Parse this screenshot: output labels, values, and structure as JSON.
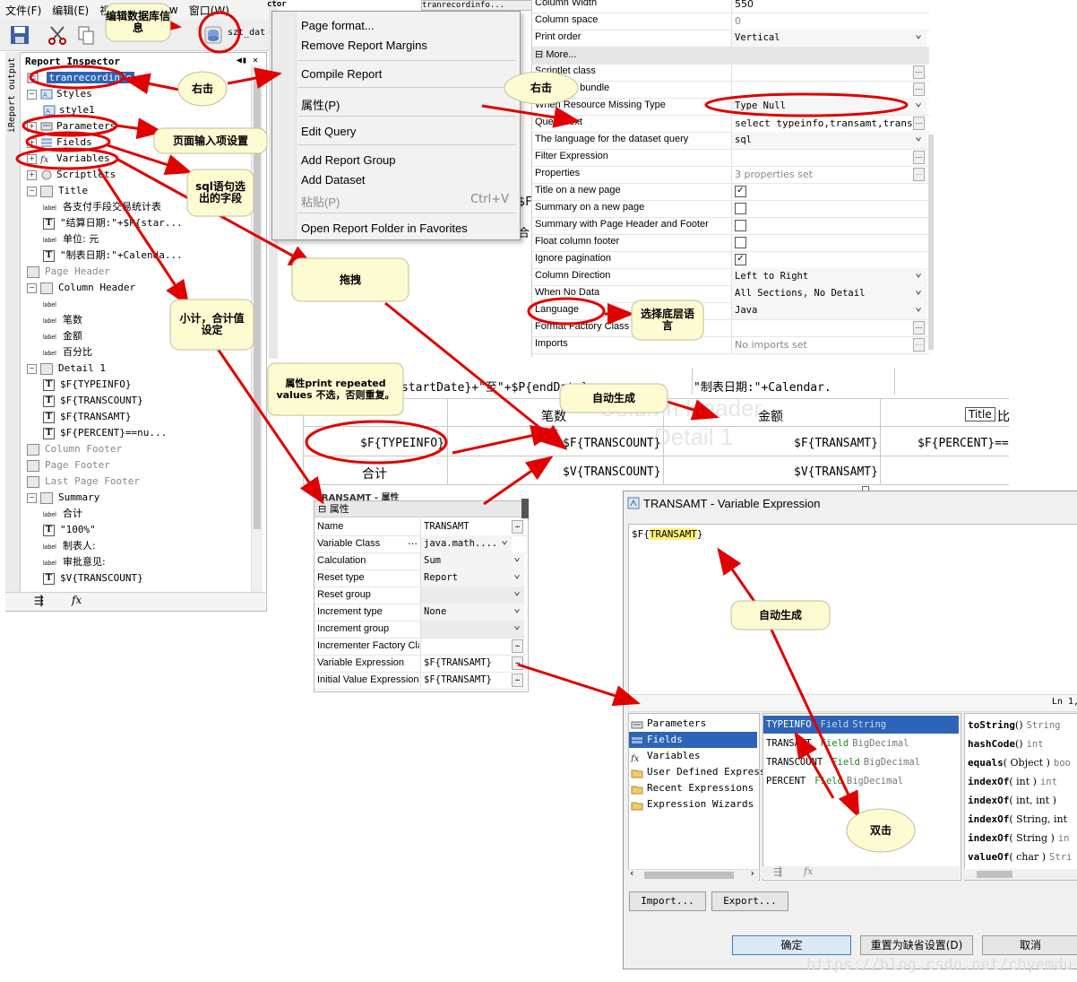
{
  "menubar": {
    "items": [
      "文件(F)",
      "编辑(E)",
      "视",
      "t",
      "Preview",
      "窗口(W)"
    ]
  },
  "toolbar": {
    "combo_value": "szt_dat"
  },
  "side_tabs": [
    "output",
    "iReport"
  ],
  "inspector": {
    "title": "Report Inspector",
    "controls": "◀▮ ✕",
    "root": "tranrecordinfo",
    "rows": [
      {
        "label": "Styles",
        "kind": "folder",
        "exp": "−"
      },
      {
        "label": "style1",
        "kind": "style"
      },
      {
        "label": "Parameters",
        "kind": "param",
        "exp": "+"
      },
      {
        "label": "Fields",
        "kind": "field",
        "exp": "+"
      },
      {
        "label": "Variables",
        "kind": "var",
        "exp": "+"
      },
      {
        "label": "Scriptlets",
        "kind": "scriptlet",
        "exp": "+"
      },
      {
        "label": "Title",
        "kind": "band",
        "exp": "−"
      },
      {
        "label": "各支付手段交易统计表",
        "kind": "label"
      },
      {
        "label": "\"结算日期:\"+$P{star...",
        "kind": "text"
      },
      {
        "label": "单位: 元",
        "kind": "label"
      },
      {
        "label": "\"制表日期:\"+Calenda...",
        "kind": "text"
      },
      {
        "label": "Page Header",
        "kind": "band",
        "muted": true
      },
      {
        "label": "Column Header",
        "kind": "band",
        "exp": "−"
      },
      {
        "label": "",
        "kind": "label"
      },
      {
        "label": "笔数",
        "kind": "label"
      },
      {
        "label": "金额",
        "kind": "label"
      },
      {
        "label": "百分比",
        "kind": "label"
      },
      {
        "label": "Detail 1",
        "kind": "band",
        "exp": "−"
      },
      {
        "label": "$F{TYPEINFO}",
        "kind": "text"
      },
      {
        "label": "$F{TRANSCOUNT}",
        "kind": "text"
      },
      {
        "label": "$F{TRANSAMT}",
        "kind": "text"
      },
      {
        "label": "$F{PERCENT}==nu...",
        "kind": "text"
      },
      {
        "label": "Column Footer",
        "kind": "band",
        "muted": true
      },
      {
        "label": "Page Footer",
        "kind": "band",
        "muted": true
      },
      {
        "label": "Last Page Footer",
        "kind": "band",
        "muted": true
      },
      {
        "label": "Summary",
        "kind": "band",
        "exp": "−"
      },
      {
        "label": "合计",
        "kind": "label"
      },
      {
        "label": "\"100%\"",
        "kind": "text"
      },
      {
        "label": "制表人:",
        "kind": "label"
      },
      {
        "label": "审批意见:",
        "kind": "label"
      },
      {
        "label": "$V{TRANSCOUNT}",
        "kind": "text"
      }
    ]
  },
  "context_menu": {
    "items": [
      {
        "label": "Page format..."
      },
      {
        "label": "Remove Report Margins"
      },
      {
        "label": "Compile Report"
      },
      {
        "label": "属性(P)"
      },
      {
        "label": "Edit Query"
      },
      {
        "label": "Add Report Group"
      },
      {
        "label": "Add Dataset"
      },
      {
        "label": "粘贴(P)",
        "shortcut": "Ctrl+V",
        "disabled": true
      },
      {
        "label": "Open Report Folder in Favorites"
      }
    ]
  },
  "mid_tab": "tranrecordinfo...",
  "mid_tab2": "ctor",
  "mid_peek": [
    "$F",
    "合"
  ],
  "props": {
    "rows": [
      {
        "name": "Column Width",
        "value": "550",
        "type": "text"
      },
      {
        "name": "Column space",
        "value": "0",
        "type": "text",
        "grey": true
      },
      {
        "name": "Print order",
        "value": "Vertical",
        "type": "combo"
      },
      {
        "name": "⊟ More...",
        "value": "",
        "type": "more"
      },
      {
        "name": "Scriptlet class",
        "value": "",
        "type": "dots"
      },
      {
        "name": "Resource bundle",
        "value": "",
        "type": "dots"
      },
      {
        "name": "When Resource Missing Type",
        "value": "Type Null",
        "type": "combo"
      },
      {
        "name": "Query Text",
        "value": "select typeinfo,transamt,trans...",
        "type": "dots"
      },
      {
        "name": "The language for the dataset query",
        "value": "sql",
        "type": "combo"
      },
      {
        "name": "Filter Expression",
        "value": "",
        "type": "dots"
      },
      {
        "name": "Properties",
        "value": "3 properties set",
        "type": "dots",
        "grey": true
      },
      {
        "name": "Title on a new page",
        "value": "✓",
        "type": "check"
      },
      {
        "name": "Summary on a new page",
        "value": "",
        "type": "check"
      },
      {
        "name": "Summary with Page Header and Footer",
        "value": "",
        "type": "check"
      },
      {
        "name": "Float column footer",
        "value": "",
        "type": "check"
      },
      {
        "name": "Ignore pagination",
        "value": "✓",
        "type": "check"
      },
      {
        "name": "Column Direction",
        "value": "Left to Right",
        "type": "combo"
      },
      {
        "name": "When No Data",
        "value": "All Sections, No Detail",
        "type": "combo"
      },
      {
        "name": "Language",
        "value": "Java",
        "type": "combo"
      },
      {
        "name": "Format Factory Class",
        "value": "",
        "type": "dots"
      },
      {
        "name": "Imports",
        "value": "No imports set",
        "type": "dots",
        "grey": true
      }
    ]
  },
  "design": {
    "top_left": "startDate}+\"至\"+$P{endDate}",
    "top_right": "\"制表日期:\"+Calendar.",
    "col_bishu": "笔数",
    "col_jine": "金额",
    "col_bi": "比",
    "title_tag": "Title",
    "ghost_header": "Column Header",
    "ghost_detail": "Detail 1",
    "det_type": "$F{TYPEINFO}",
    "det_count": "$F{TRANSCOUNT}",
    "det_amt": "$F{TRANSAMT}",
    "det_pct": "$F{PERCENT}==",
    "sum_label": "合计",
    "sum_count": "$V{TRANSCOUNT}",
    "sum_amt": "$V{TRANSAMT}"
  },
  "vprops": {
    "partial_header": "TRANSAMT - 属性",
    "header": "⊟ 属性",
    "rows": [
      {
        "name": "Name",
        "value": "TRANSAMT",
        "type": "dots"
      },
      {
        "name": "Variable Class",
        "value": "java.math....",
        "type": "combo_dots"
      },
      {
        "name": "Calculation",
        "value": "Sum",
        "type": "combo"
      },
      {
        "name": "Reset type",
        "value": "Report",
        "type": "combo"
      },
      {
        "name": "Reset group",
        "value": "",
        "type": "combo_dis"
      },
      {
        "name": "Increment type",
        "value": "None",
        "type": "combo"
      },
      {
        "name": "Increment group",
        "value": "",
        "type": "combo_dis"
      },
      {
        "name": "Incrementer Factory Cla",
        "value": "",
        "type": "dots"
      },
      {
        "name": "Variable Expression",
        "value": "$F{TRANSAMT}",
        "type": "dots"
      },
      {
        "name": "Initial Value Expression",
        "value": "$F{TRANSAMT}",
        "type": "dots"
      }
    ]
  },
  "dialog": {
    "title": "TRANSAMT - Variable Expression",
    "expr_prefix": "$F{",
    "expr_hl": "TRANSAMT",
    "expr_suffix": "}",
    "line_indicator": "Ln 1,",
    "pane1": [
      {
        "label": "Parameters",
        "icon": "param"
      },
      {
        "label": "Fields",
        "icon": "field",
        "sel": true
      },
      {
        "label": "Variables",
        "icon": "var"
      },
      {
        "label": "User Defined Express:",
        "icon": "folder"
      },
      {
        "label": "Recent Expressions",
        "icon": "folder"
      },
      {
        "label": "Expression Wizards",
        "icon": "folder"
      }
    ],
    "pane2": [
      {
        "name": "TYPEINFO",
        "kind": "Field",
        "type": "String",
        "sel": true
      },
      {
        "name": "TRANSAMT",
        "kind": "Field",
        "type": "BigDecimal"
      },
      {
        "name": "TRANSCOUNT",
        "kind": "Field",
        "type": "BigDecimal"
      },
      {
        "name": "PERCENT",
        "kind": "Field",
        "type": "BigDecimal"
      }
    ],
    "pane3": [
      {
        "m": "toString",
        "a": "()",
        "r": "String"
      },
      {
        "m": "hashCode",
        "a": "()",
        "r": "int"
      },
      {
        "m": "equals",
        "a": "( Object )",
        "r": "boo"
      },
      {
        "m": "indexOf",
        "a": "( int )",
        "r": "int"
      },
      {
        "m": "indexOf",
        "a": "( int, int )",
        "r": ""
      },
      {
        "m": "indexOf",
        "a": "( String, int",
        "r": ""
      },
      {
        "m": "indexOf",
        "a": "( String )",
        "r": "in"
      },
      {
        "m": "valueOf",
        "a": "( char )",
        "r": "Stri"
      }
    ],
    "import_label": "Import...",
    "export_label": "Export...",
    "ok_label": "确定",
    "reset_label": "重置为缺省设置(D)",
    "cancel_label": "取消"
  },
  "annotations": {
    "edit_db": "编辑数据库信息",
    "right_click_1": "右击",
    "right_click_2": "右击",
    "page_input": "页面输入项设置",
    "sql_fields": "sql语句选出的字段",
    "drag": "拖拽",
    "subtotal": "小计，合计值设定",
    "select_lang": "选择底层语言",
    "print_repeated": "属性print repeated values 不选，否则重复。",
    "auto_gen_1": "自动生成",
    "auto_gen_2": "自动生成",
    "double_click": "双击"
  },
  "watermark": "https://blog.csdn.net/chyemdu",
  "colors": {
    "selection": "#2e64b8",
    "annotation_red": "#e00000",
    "bubble_fill": "#fdfbd2"
  }
}
